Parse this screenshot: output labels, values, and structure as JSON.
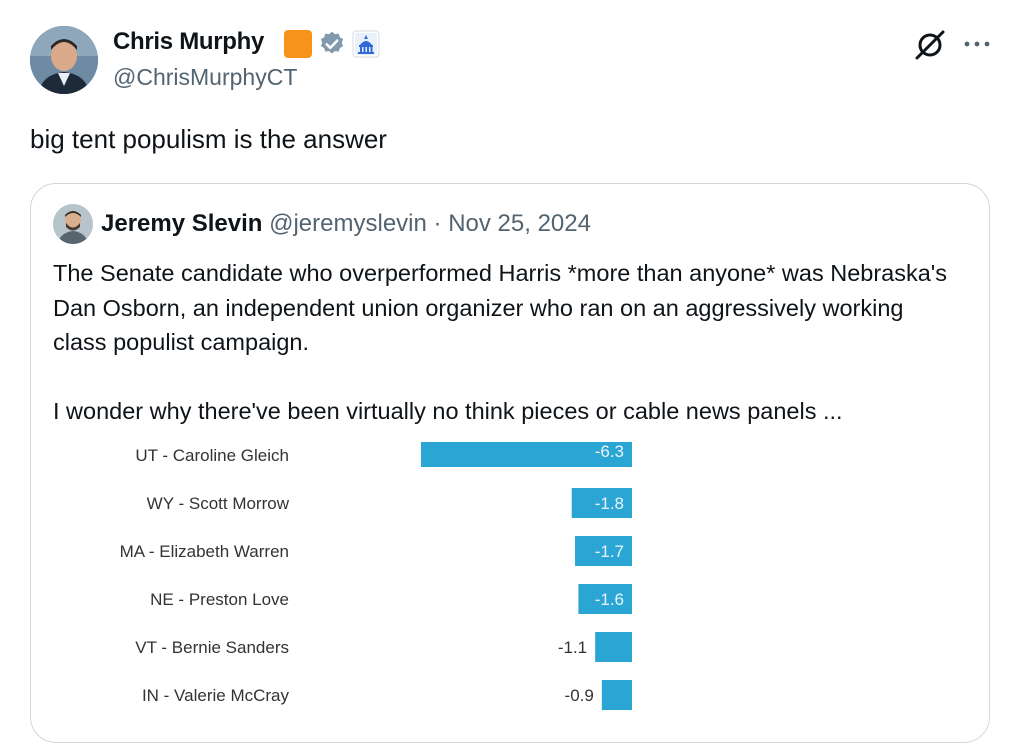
{
  "tweet": {
    "author_name": "Chris Murphy",
    "author_handle": "@ChrisMurphyCT",
    "text": "big tent populism is the answer",
    "colors": {
      "badge_orange": "#f7931a",
      "verified_gray": "#829aab",
      "senate_blue": "#2f6bd8"
    }
  },
  "quoted_tweet": {
    "author_name": "Jeremy Slevin",
    "author_handle": "@jeremyslevin",
    "separator": "·",
    "date": "Nov 25, 2024",
    "paragraph1": "The Senate candidate who overperformed Harris *more than anyone* was Nebraska's Dan Osborn, an independent union organizer who ran on an aggressively working class populist campaign.",
    "paragraph2": "I wonder why there've been virtually no think pieces or cable news panels ..."
  },
  "chart_data": {
    "type": "bar",
    "orientation": "horizontal",
    "bar_color": "#2aa5d4",
    "categories": [
      "UT - Caroline Gleich",
      "WY - Scott Morrow",
      "MA - Elizabeth Warren",
      "NE - Preston Love",
      "VT - Bernie Sanders",
      "IN - Valerie McCray"
    ],
    "values": [
      -6.3,
      -1.8,
      -1.7,
      -1.6,
      -1.1,
      -0.9
    ],
    "labels": [
      "-6.3",
      "-1.8",
      "-1.7",
      "-1.6",
      "-1.1",
      "-0.9"
    ]
  }
}
